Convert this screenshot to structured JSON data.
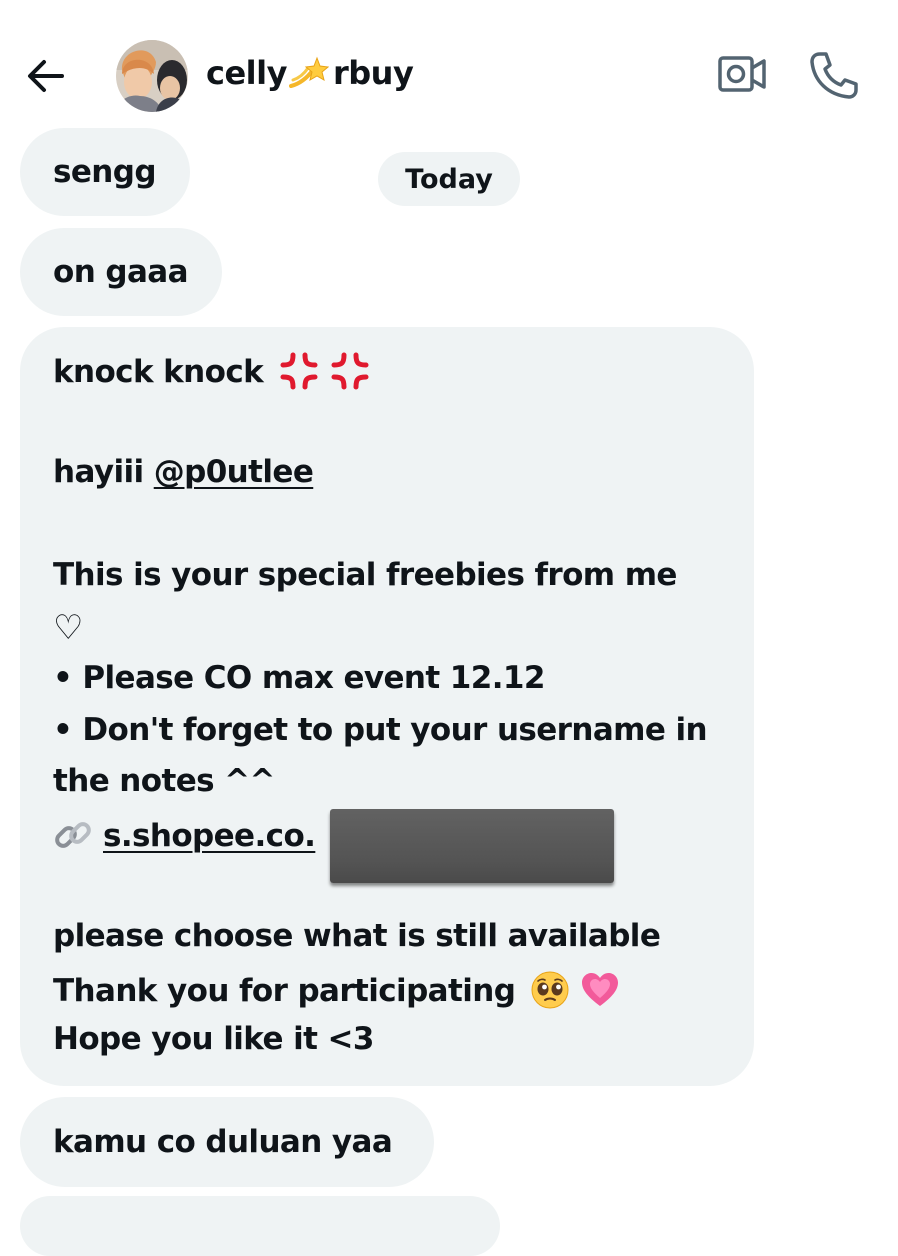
{
  "header": {
    "contact_name_part1": "celly",
    "contact_name_part2": "rbuy",
    "icons": {
      "back": "arrow-left-icon",
      "video": "video-camera-icon",
      "call": "phone-icon"
    }
  },
  "date_divider": "Today",
  "messages": [
    {
      "text": "sengg"
    },
    {
      "text": "on gaaa"
    },
    {
      "lines": {
        "l1": "knock knock",
        "l2_prefix": "hayiii ",
        "l2_mention": "@p0utlee",
        "l3": "This is your special freebies from me",
        "l4": "♡",
        "l5": "• Please CO max event 12.12",
        "l6": "• Don't forget to put your username in",
        "l7": "the notes ^^",
        "l8_link": "s.shopee.co.",
        "l9": "please choose what is still available",
        "l10": "Thank you for participating",
        "l11": "Hope you like it <3"
      }
    },
    {
      "text": "kamu co duluan yaa"
    }
  ],
  "colors": {
    "bubble": "#eff3f4",
    "text": "#0f1419",
    "icon": "#536471",
    "anger_emoji": "#e0192e",
    "heart_emoji": "#f25a9a"
  }
}
